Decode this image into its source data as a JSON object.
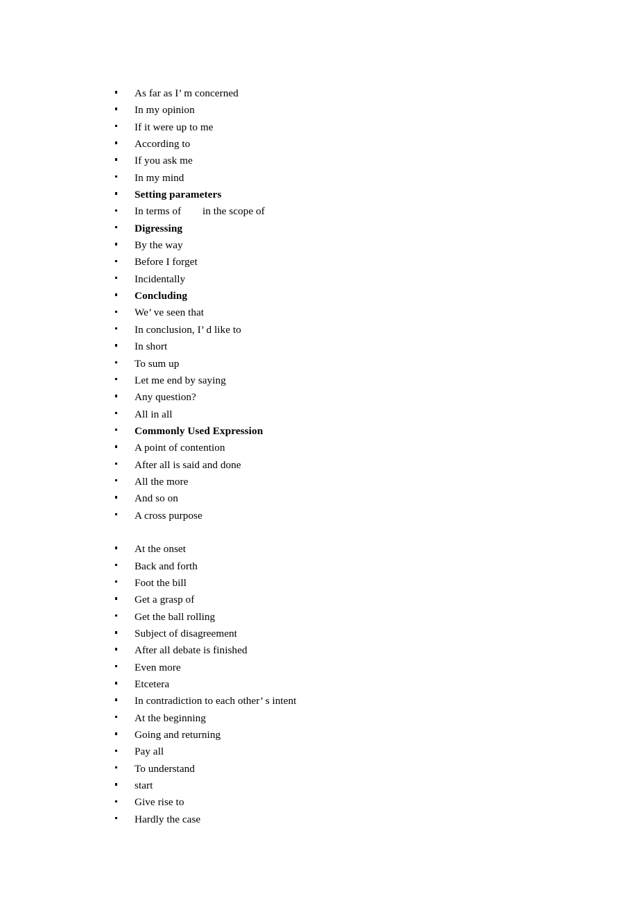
{
  "document": {
    "background_color": "#ffffff",
    "text_color": "#000000",
    "bullet_glyph": "square-bullet"
  },
  "blocks": [
    {
      "name": "expressions-list-primary",
      "items": [
        {
          "text": "As far as I’ m concerned",
          "bold": false
        },
        {
          "text": "In my opinion",
          "bold": false
        },
        {
          "text": "If it were up to me",
          "bold": false
        },
        {
          "text": "According to",
          "bold": false
        },
        {
          "text": "If you ask me",
          "bold": false
        },
        {
          "text": "In my mind",
          "bold": false
        },
        {
          "text": "Setting parameters",
          "bold": true
        },
        {
          "text": "In terms of        in the scope of",
          "bold": false
        },
        {
          "text": "Digressing",
          "bold": true
        },
        {
          "text": "By the way",
          "bold": false
        },
        {
          "text": "Before I forget",
          "bold": false
        },
        {
          "text": "Incidentally",
          "bold": false
        },
        {
          "text": "Concluding",
          "bold": true
        },
        {
          "text": "We’ ve seen that",
          "bold": false
        },
        {
          "text": "In conclusion, I’ d like to",
          "bold": false
        },
        {
          "text": "In short",
          "bold": false
        },
        {
          "text": "To sum up",
          "bold": false
        },
        {
          "text": "Let me end by saying",
          "bold": false
        },
        {
          "text": "Any question?",
          "bold": false
        },
        {
          "text": "All in all",
          "bold": false
        },
        {
          "text": "Commonly Used Expression",
          "bold": true
        },
        {
          "text": "A point of contention",
          "bold": false
        },
        {
          "text": "After all is said and done",
          "bold": false
        },
        {
          "text": "All the more",
          "bold": false
        },
        {
          "text": "And so on",
          "bold": false
        },
        {
          "text": "A cross purpose",
          "bold": false
        }
      ]
    },
    {
      "name": "expressions-list-secondary",
      "items": [
        {
          "text": "At the onset",
          "bold": false
        },
        {
          "text": "Back and forth",
          "bold": false
        },
        {
          "text": "Foot the bill",
          "bold": false
        },
        {
          "text": "Get a grasp of",
          "bold": false
        },
        {
          "text": "Get the ball rolling",
          "bold": false
        },
        {
          "text": "Subject of disagreement",
          "bold": false
        },
        {
          "text": "After all debate is finished",
          "bold": false
        },
        {
          "text": "Even more",
          "bold": false
        },
        {
          "text": "Etcetera",
          "bold": false
        },
        {
          "text": "In contradiction to each other’ s intent",
          "bold": false
        },
        {
          "text": "At the beginning",
          "bold": false
        },
        {
          "text": "Going and returning",
          "bold": false
        },
        {
          "text": "Pay all",
          "bold": false
        },
        {
          "text": "To understand",
          "bold": false
        },
        {
          "text": "start",
          "bold": false
        },
        {
          "text": "Give rise to",
          "bold": false
        },
        {
          "text": "Hardly the case",
          "bold": false
        }
      ]
    }
  ]
}
